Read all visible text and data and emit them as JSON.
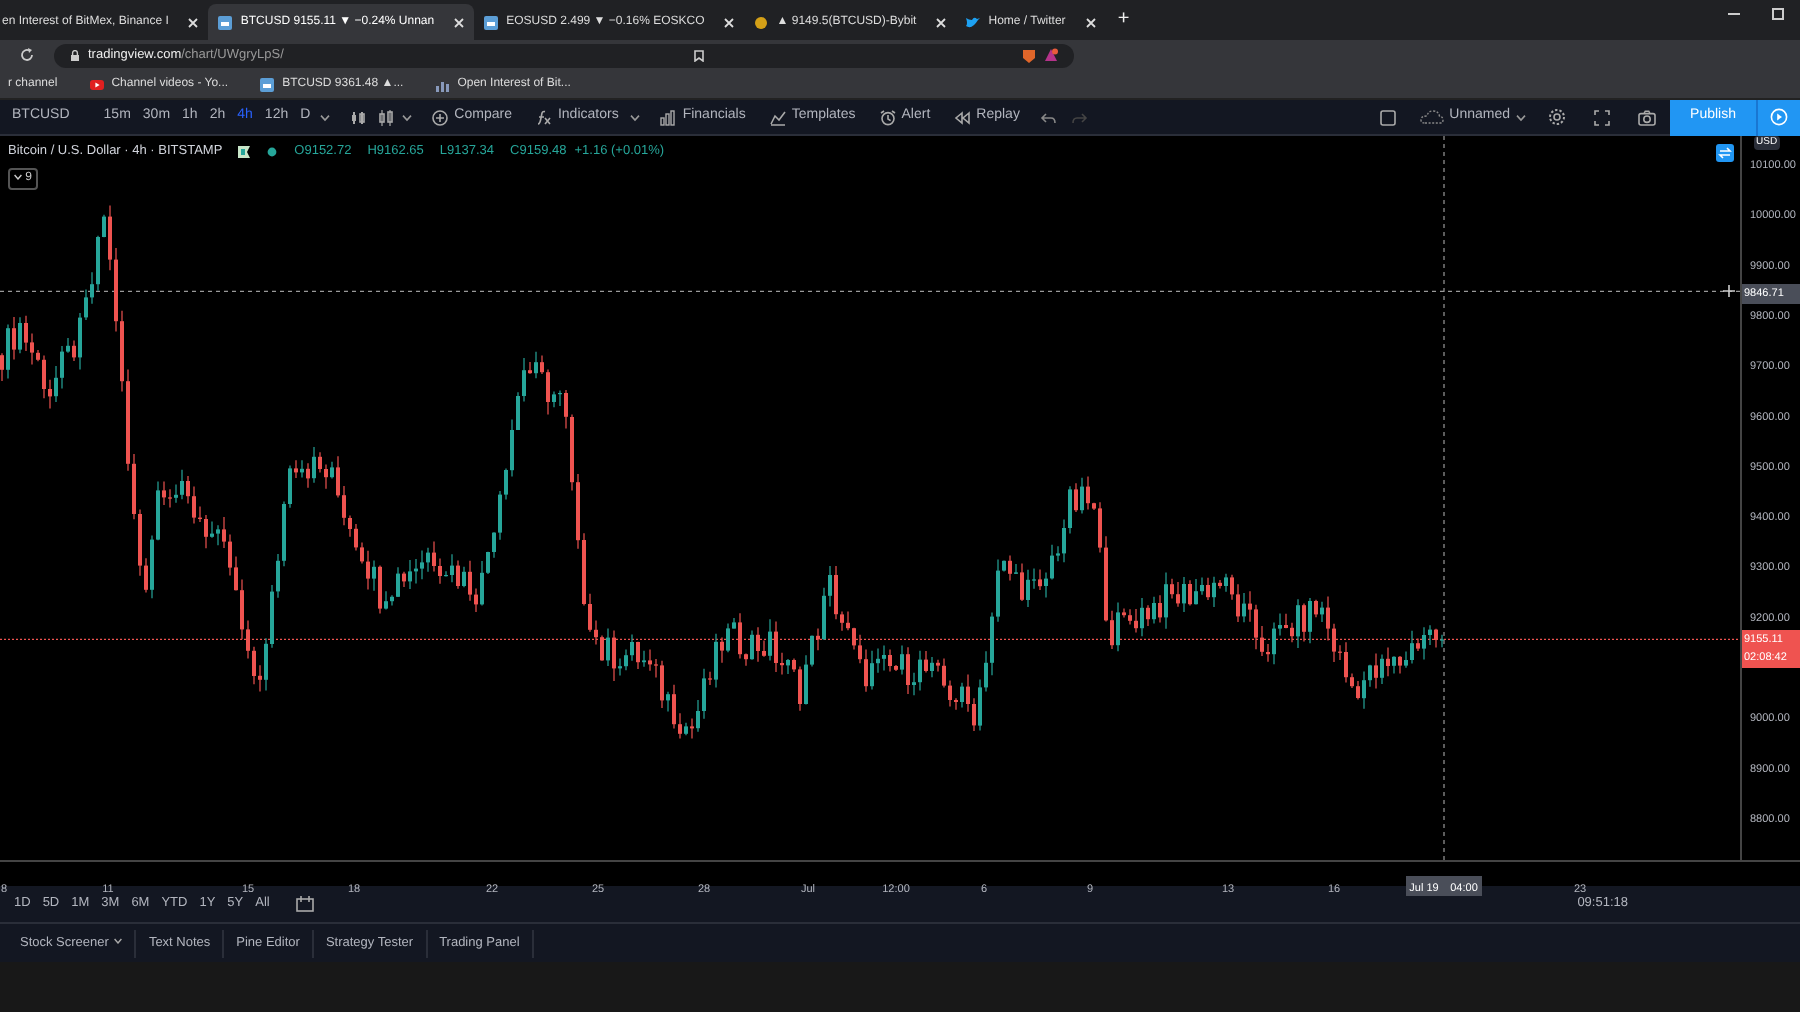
{
  "browser": {
    "tabs": [
      {
        "title": "en Interest of BitMex, Binance I",
        "kind": "plain",
        "selected": false
      },
      {
        "title": "BTCUSD 9155.11 ▼ −0.24% Unnan",
        "kind": "tv",
        "selected": true
      },
      {
        "title": "EOSUSD 2.499 ▼ −0.16% EOSKCO",
        "kind": "tv",
        "selected": false
      },
      {
        "title": "▲ 9149.5(BTCUSD)-Bybit",
        "kind": "coin",
        "selected": false
      },
      {
        "title": "Home / Twitter",
        "kind": "bird",
        "selected": false
      }
    ],
    "new_tab": "+",
    "address": {
      "host": "tradingview.com",
      "path": "/chart/UWgryLpS/"
    },
    "bookmarks": [
      {
        "label": "r channel",
        "kind": "plain"
      },
      {
        "label": "Channel videos - Yo...",
        "kind": "video"
      },
      {
        "label": "BTCUSD 9361.48 ▲...",
        "kind": "tv"
      },
      {
        "label": "Open Interest of Bit...",
        "kind": "chart"
      }
    ]
  },
  "toolbar": {
    "symbol": "BTCUSD",
    "intervals": [
      {
        "label": "15m",
        "selected": false
      },
      {
        "label": "30m",
        "selected": false
      },
      {
        "label": "1h",
        "selected": false
      },
      {
        "label": "2h",
        "selected": false
      },
      {
        "label": "4h",
        "selected": true
      },
      {
        "label": "12h",
        "selected": false
      },
      {
        "label": "D",
        "selected": false
      }
    ],
    "buttons": [
      {
        "label": "Compare",
        "kind": "plus"
      },
      {
        "label": "Indicators",
        "kind": "fx"
      },
      {
        "label": "Financials",
        "kind": "bars"
      },
      {
        "label": "Templates",
        "kind": "tpl"
      },
      {
        "label": "Alert",
        "kind": "clock"
      },
      {
        "label": "Replay",
        "kind": "rewind"
      }
    ],
    "layout_name": "Unnamed",
    "publish": "Publish"
  },
  "legend": {
    "title": "Bitcoin / U.S. Dollar · 4h · BITSTAMP",
    "open": "O9152.72",
    "high": "H9162.65",
    "low": "L9137.34",
    "close": "C9159.48",
    "change": "+1.16 (+0.01%)",
    "indicators": "9"
  },
  "price_axis": {
    "currency": "USD",
    "ticks": [
      "10100.00",
      "10000.00",
      "9900.00",
      "9800.00",
      "9700.00",
      "9600.00",
      "9500.00",
      "9400.00",
      "9300.00",
      "9200.00",
      "9000.00",
      "8900.00",
      "8800.00"
    ],
    "crosshair_label": "9846.71",
    "last_price": "9155.11",
    "countdown": "02:08:42"
  },
  "time_axis": {
    "ticks": [
      "8",
      "11",
      "15",
      "18",
      "22",
      "25",
      "28",
      "Jul",
      "12:00",
      "6",
      "9",
      "13",
      "16",
      "23"
    ],
    "crosshair_date": "Jul 19",
    "crosshair_time": "04:00"
  },
  "ranges": [
    "1D",
    "5D",
    "1M",
    "3M",
    "6M",
    "YTD",
    "1Y",
    "5Y",
    "All"
  ],
  "clock": "09:51:18",
  "bottom_tabs": [
    "Stock Screener",
    "Text Notes",
    "Pine Editor",
    "Strategy Tester",
    "Trading Panel"
  ]
}
